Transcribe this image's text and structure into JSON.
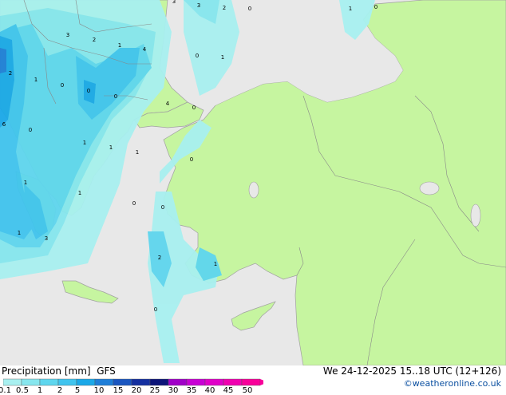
{
  "footer": {
    "title": "Precipitation [mm]  GFS",
    "valid_time": "We 24-12-2025 15..18 UTC (12+126)",
    "credit": "©weatheronline.co.uk"
  },
  "legend": {
    "ticks": [
      "0.1",
      "0.5",
      "1",
      "2",
      "5",
      "10",
      "15",
      "20",
      "25",
      "30",
      "35",
      "40",
      "45",
      "50"
    ],
    "colors": [
      "#a8f0f0",
      "#86e6ee",
      "#5ed6ee",
      "#40c4ee",
      "#1aa8e8",
      "#1e7ed8",
      "#1a56c0",
      "#1430a0",
      "#0c1478",
      "#a000c8",
      "#c800d4",
      "#e000c8",
      "#f000b0",
      "#f8009a"
    ]
  },
  "map": {
    "colors": {
      "sea": "#e8e8e8",
      "land": "#c6f5a0",
      "border": "#888888",
      "coast": "#a0a0a0"
    },
    "labels": [
      "3",
      "3",
      "2",
      "0",
      "1",
      "0",
      "3",
      "2",
      "1",
      "4",
      "0",
      "1",
      "2",
      "1",
      "0",
      "0",
      "0",
      "4",
      "0",
      "6",
      "0",
      "1",
      "1",
      "1",
      "0",
      "1",
      "1",
      "0",
      "0",
      "1",
      "3",
      "2",
      "1",
      "0"
    ]
  }
}
